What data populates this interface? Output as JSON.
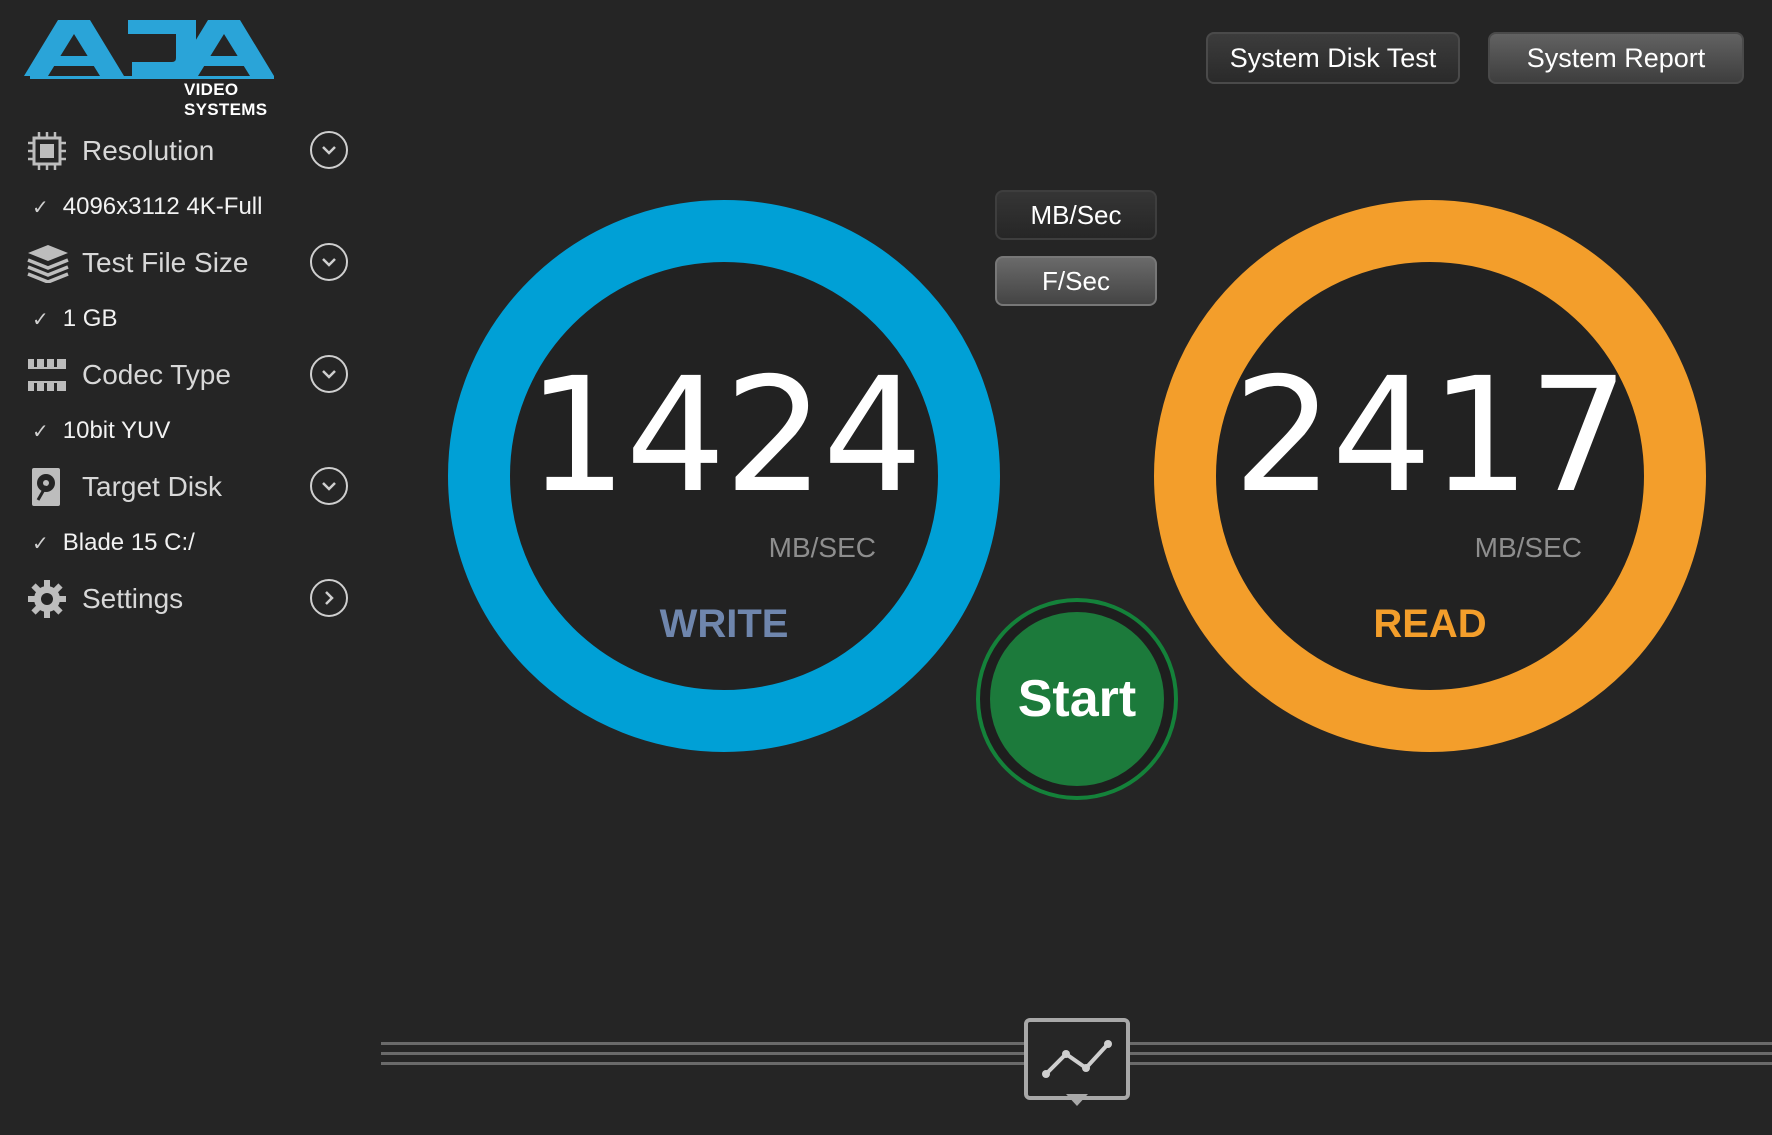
{
  "brand": {
    "subtitle": "VIDEO SYSTEMS",
    "logo_color": "#2aa4d8"
  },
  "header": {
    "system_disk_test_label": "System Disk Test",
    "system_report_label": "System Report"
  },
  "sidebar": {
    "items": [
      {
        "label": "Resolution",
        "value": "4096x3112 4K-Full",
        "icon": "chip-icon"
      },
      {
        "label": "Test File Size",
        "value": "1 GB",
        "icon": "layers-icon"
      },
      {
        "label": "Codec Type",
        "value": "10bit YUV",
        "icon": "film-icon"
      },
      {
        "label": "Target Disk",
        "value": "Blade 15 C:/",
        "icon": "disk-icon"
      },
      {
        "label": "Settings",
        "icon": "gear-icon"
      }
    ],
    "check_mark": "✓"
  },
  "units": {
    "mb_label": "MB/Sec",
    "fs_label": "F/Sec"
  },
  "write": {
    "value": "1424",
    "unit": "MB/SEC",
    "label": "WRITE",
    "color": "#00a0d6"
  },
  "read": {
    "value": "2417",
    "unit": "MB/SEC",
    "label": "READ",
    "color": "#f39e2b"
  },
  "start": {
    "label": "Start",
    "color": "#1c7a3b"
  }
}
